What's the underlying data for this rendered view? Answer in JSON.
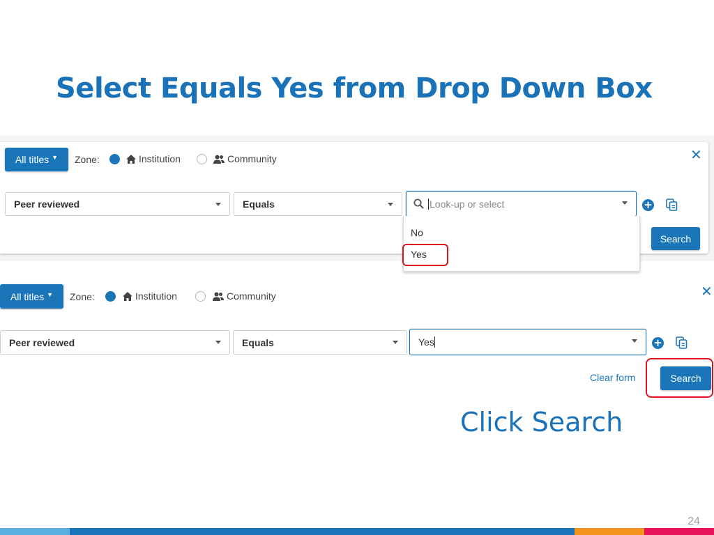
{
  "slide": {
    "title": "Select Equals Yes from Drop Down Box",
    "callout": "Click Search",
    "page_number": "24"
  },
  "panel1": {
    "scope_button": "All titles",
    "zone_label": "Zone:",
    "zone_options": [
      {
        "label": "Institution",
        "icon": "home-icon",
        "selected": true
      },
      {
        "label": "Community",
        "icon": "users-icon",
        "selected": false
      }
    ],
    "field_select": "Peer reviewed",
    "operator_select": "Equals",
    "value_placeholder": "Look-up or select",
    "dropdown_options": [
      "No",
      "Yes"
    ],
    "highlighted_option": "Yes",
    "search_button": "Search"
  },
  "panel2": {
    "scope_button": "All titles",
    "zone_label": "Zone:",
    "zone_options": [
      {
        "label": "Institution",
        "icon": "home-icon",
        "selected": true
      },
      {
        "label": "Community",
        "icon": "users-icon",
        "selected": false
      }
    ],
    "field_select": "Peer reviewed",
    "operator_select": "Equals",
    "value_input": "Yes",
    "clear_form_link": "Clear form",
    "search_button": "Search"
  },
  "colors": {
    "accent": "#1a76b8",
    "title": "#1a73b8",
    "highlight": "#e0141e",
    "footer": [
      "#5aaee0",
      "#1a76b8",
      "#f7941d",
      "#e8145a"
    ]
  }
}
